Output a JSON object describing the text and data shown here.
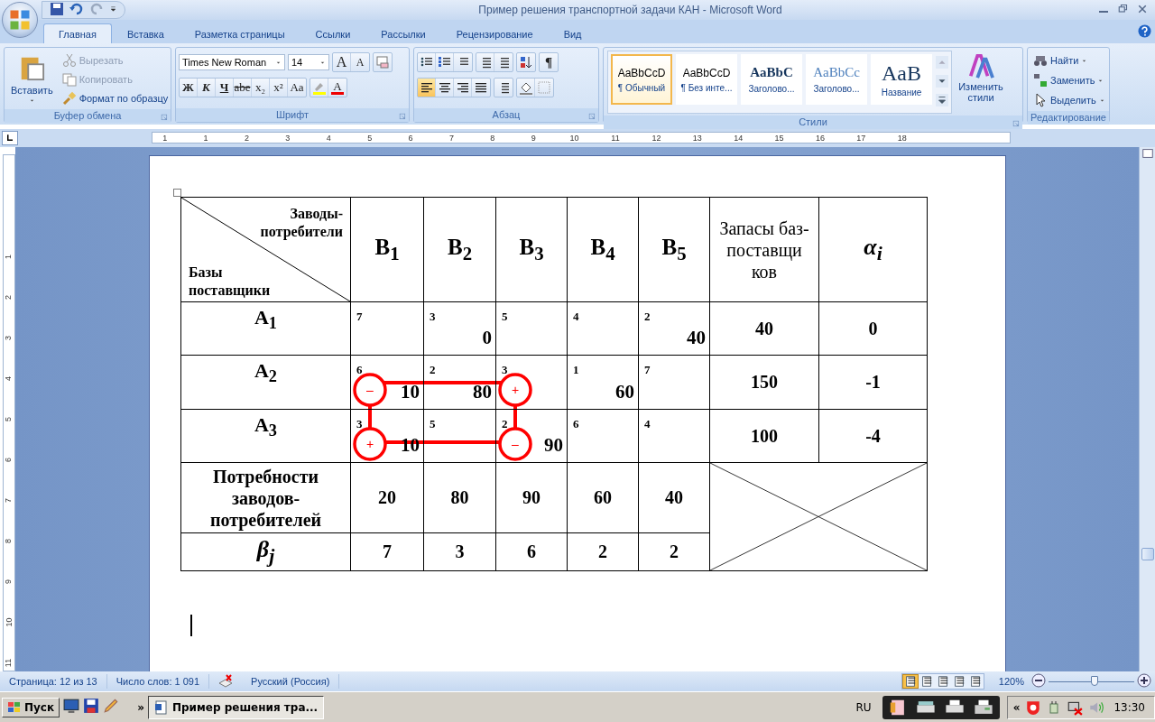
{
  "window": {
    "title": "Пример решения транспортной задачи КАН - Microsoft Word"
  },
  "tabs": [
    {
      "label": "Главная",
      "selected": true
    },
    {
      "label": "Вставка",
      "selected": false
    },
    {
      "label": "Разметка страницы",
      "selected": false
    },
    {
      "label": "Ссылки",
      "selected": false
    },
    {
      "label": "Рассылки",
      "selected": false
    },
    {
      "label": "Рецензирование",
      "selected": false
    },
    {
      "label": "Вид",
      "selected": false
    }
  ],
  "ribbon": {
    "clipboard": {
      "title": "Буфер обмена",
      "paste": "Вставить",
      "items": [
        {
          "label": "Вырезать",
          "disabled": true
        },
        {
          "label": "Копировать",
          "disabled": true
        },
        {
          "label": "Формат по образцу",
          "disabled": false
        }
      ]
    },
    "font": {
      "title": "Шрифт",
      "family": "Times New Roman",
      "size": "14",
      "size_buttons": [
        "A",
        "A"
      ],
      "format_buttons": [
        {
          "label": "Ж",
          "kind": "bold"
        },
        {
          "label": "К",
          "kind": "italic"
        },
        {
          "label": "Ч",
          "kind": "underline"
        },
        {
          "label": "abe",
          "kind": "strike"
        },
        {
          "label": "x₂",
          "kind": "plain"
        },
        {
          "label": "x²",
          "kind": "plain"
        },
        {
          "label": "Aa",
          "kind": "plain"
        }
      ],
      "color_button": "A"
    },
    "paragraph": {
      "title": "Абзац",
      "pilcrow": "¶",
      "alignments": [
        {
          "selected": true
        },
        {
          "selected": false
        },
        {
          "selected": false
        },
        {
          "selected": false
        }
      ]
    },
    "styles": {
      "title": "Стили",
      "items": [
        {
          "preview": "AaBbCcD",
          "name": "¶ Обычный",
          "selected": true
        },
        {
          "preview": "AaBbCcD",
          "name": "¶ Без инте...",
          "selected": false
        },
        {
          "preview": "AaBbC",
          "name": "Заголово...",
          "selected": false
        },
        {
          "preview": "AaBbCc",
          "name": "Заголово...",
          "selected": false
        },
        {
          "preview": "AaB",
          "name": "Название",
          "selected": false
        }
      ],
      "change": "Изменить стили"
    },
    "editing": {
      "title": "Редактирование",
      "items": [
        "Найти",
        "Заменить",
        "Выделить"
      ]
    }
  },
  "ruler": {
    "marks": [
      "1",
      "1",
      "2",
      "3",
      "4",
      "5",
      "6",
      "7",
      "8",
      "9",
      "10",
      "11",
      "12",
      "13",
      "14",
      "15",
      "16",
      "17",
      "18"
    ],
    "vertical_marks": [
      "1",
      "2",
      "3",
      "4",
      "5",
      "6",
      "7",
      "8",
      "9",
      "10",
      "11"
    ]
  },
  "table": {
    "corner_top": "Заводы-потребители",
    "corner_bottom": "Базы поставщики",
    "columns": [
      "В$_{1}$",
      "В$_{2}$",
      "В$_{3}$",
      "В$_{4}$",
      "В$_{5}$"
    ],
    "supply_header": "Запасы баз-поставщи ков",
    "alpha_header": "α$_{i}$",
    "rows": [
      {
        "label": "А$_{1}$",
        "supply": "40",
        "alpha": "0",
        "cells": [
          {
            "cost": "7"
          },
          {
            "cost": "3",
            "amount": "0"
          },
          {
            "cost": "5"
          },
          {
            "cost": "4"
          },
          {
            "cost": "2",
            "amount": "40"
          }
        ]
      },
      {
        "label": "А$_{2}$",
        "supply": "150",
        "alpha": "-1",
        "cells": [
          {
            "cost": "6",
            "amount": "10",
            "sign": "–"
          },
          {
            "cost": "2",
            "amount": "80"
          },
          {
            "cost": "3",
            "sign": "+"
          },
          {
            "cost": "1",
            "amount": "60"
          },
          {
            "cost": "7"
          }
        ]
      },
      {
        "label": "А$_{3}$",
        "supply": "100",
        "alpha": "-4",
        "cells": [
          {
            "cost": "3",
            "amount": "10",
            "sign": "+"
          },
          {
            "cost": "5"
          },
          {
            "cost": "2",
            "amount": "90",
            "sign": "–"
          },
          {
            "cost": "6"
          },
          {
            "cost": "4"
          }
        ]
      }
    ],
    "demand_label": "Потребности заводов-потребителей",
    "demand": [
      "20",
      "80",
      "90",
      "60",
      "40"
    ],
    "beta_label": "β$_{j}$",
    "beta": [
      "7",
      "3",
      "6",
      "2",
      "2"
    ]
  },
  "status_bar": {
    "page": "Страница: 12 из 13",
    "words": "Число слов: 1 091",
    "language": "Русский (Россия)",
    "views": [
      {
        "selected": true
      },
      {
        "selected": false
      },
      {
        "selected": false
      },
      {
        "selected": false
      },
      {
        "selected": false
      }
    ],
    "zoom": "120%",
    "zoom_slider": {
      "level": 0.55
    }
  },
  "taskbar": {
    "start": "Пуск",
    "chevron": "»",
    "tasks": [
      {
        "label": "Пример решения тра...",
        "selected": true
      }
    ],
    "language": "RU",
    "tray_chevron": "«",
    "clock": "13:30"
  }
}
